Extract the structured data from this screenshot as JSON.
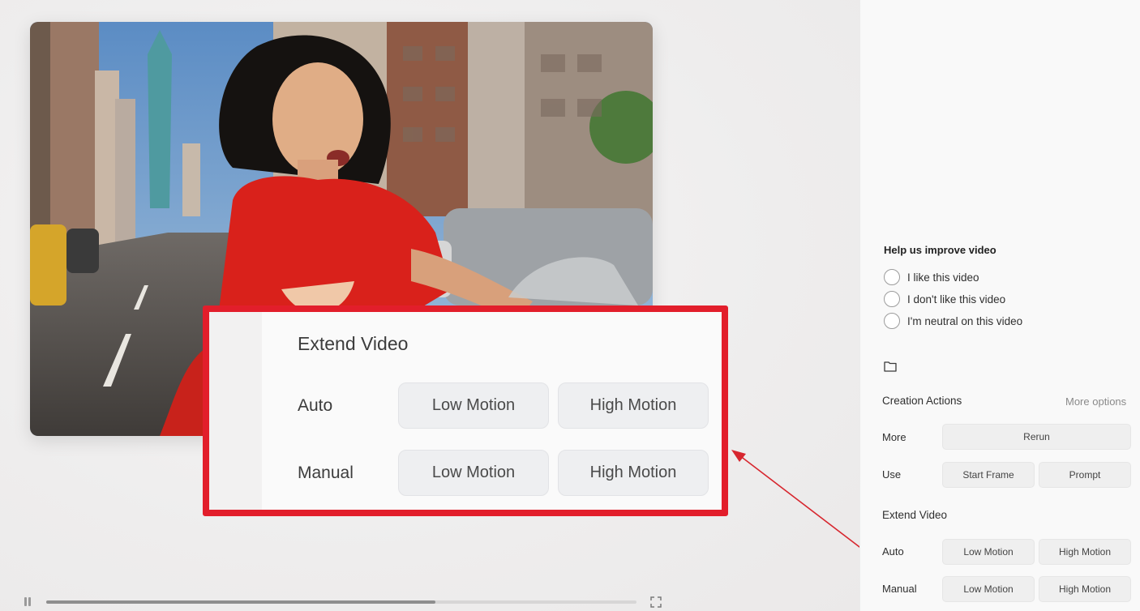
{
  "player": {
    "progress_percent": 66
  },
  "callout": {
    "title": "Extend Video",
    "rows": [
      {
        "label": "Auto",
        "low": "Low Motion",
        "high": "High Motion"
      },
      {
        "label": "Manual",
        "low": "Low Motion",
        "high": "High Motion"
      }
    ],
    "highlight_color": "#e21e2b"
  },
  "feedback": {
    "title": "Help us improve video",
    "options": [
      "I like this video",
      "I don't like this video",
      "I'm neutral on this video"
    ]
  },
  "creation": {
    "title": "Creation Actions",
    "more_options": "More options",
    "more_label": "More",
    "rerun": "Rerun",
    "use_label": "Use",
    "start_frame": "Start Frame",
    "prompt": "Prompt"
  },
  "extend": {
    "title": "Extend Video",
    "auto_label": "Auto",
    "manual_label": "Manual",
    "low_motion": "Low Motion",
    "high_motion": "High Motion"
  },
  "icons": {
    "pause": "pause-icon",
    "fullscreen": "fullscreen-icon",
    "folder": "folder-icon"
  }
}
